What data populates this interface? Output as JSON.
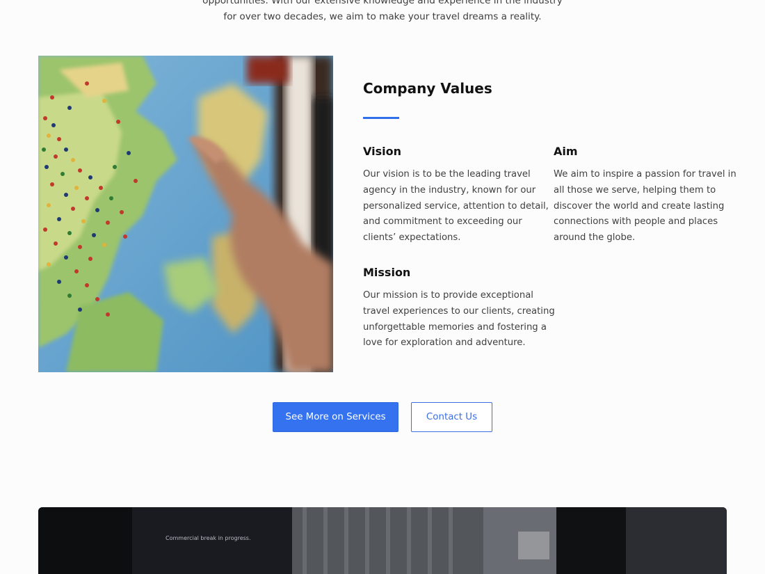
{
  "intro": {
    "line1": "opportunities. With our extensive knowledge and experience in the industry",
    "line2": "for over two decades, we aim to make your travel dreams a reality."
  },
  "values": {
    "title": "Company Values",
    "vision": {
      "heading": "Vision",
      "lines": [
        "Our vision is to be the leading travel",
        "agency in the industry, known for our",
        "personalized service, attention to detail,",
        "and commitment to exceeding our",
        "clients’ expectations."
      ]
    },
    "aim": {
      "heading": "Aim",
      "lines": [
        "We aim to inspire a passion for travel in",
        "all those we serve, helping them to",
        "discover the world and create lasting",
        "connections with people and places",
        "around the globe."
      ]
    },
    "mission": {
      "heading": "Mission",
      "lines": [
        "Our mission is to provide exceptional",
        "travel experiences to our clients, creating",
        "unforgettable memories and fostering a",
        "love for exploration and adventure."
      ]
    }
  },
  "buttons": {
    "services_label": "See More on Services",
    "contact_label": "Contact Us"
  },
  "video": {
    "caption": "Commercial break in progress."
  },
  "colors": {
    "accent": "#3472f0",
    "heading": "#111111",
    "body_text": "#3f3f3f"
  },
  "icons": {
    "map_image": "world-map-photo",
    "video_thumbnail": "office-video-thumbnail"
  }
}
